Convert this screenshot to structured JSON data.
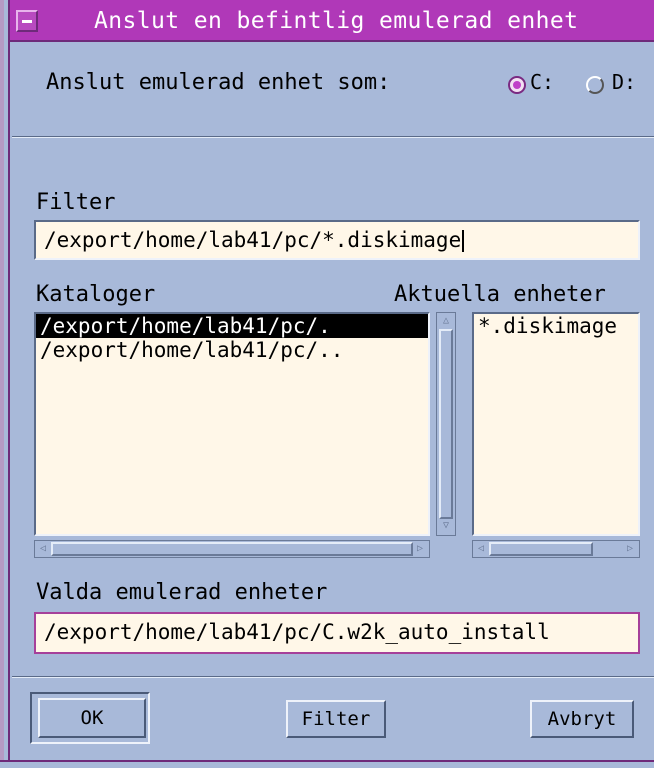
{
  "window": {
    "title": "Anslut en befintlig emulerad enhet"
  },
  "connect": {
    "label": "Anslut emulerad enhet som:",
    "options": [
      {
        "label": "C:",
        "selected": true
      },
      {
        "label": "D:",
        "selected": false
      }
    ]
  },
  "filter": {
    "label": "Filter",
    "value": "/export/home/lab41/pc/*.diskimage"
  },
  "directories": {
    "label": "Kataloger",
    "items": [
      {
        "label": "/export/home/lab41/pc/.",
        "selected": true
      },
      {
        "label": "/export/home/lab41/pc/..",
        "selected": false
      }
    ]
  },
  "devices": {
    "label": "Aktuella enheter",
    "items": [
      {
        "label": "*.diskimage"
      }
    ]
  },
  "selection": {
    "label": "Valda emulerad enheter",
    "value": "/export/home/lab41/pc/C.w2k_auto_install"
  },
  "buttons": {
    "ok": "OK",
    "filter": "Filter",
    "cancel": "Avbryt"
  },
  "colors": {
    "titlebar": "#b038b8",
    "background": "#a8b9d9",
    "field": "#fff7e8",
    "selected_row": "#000000"
  }
}
